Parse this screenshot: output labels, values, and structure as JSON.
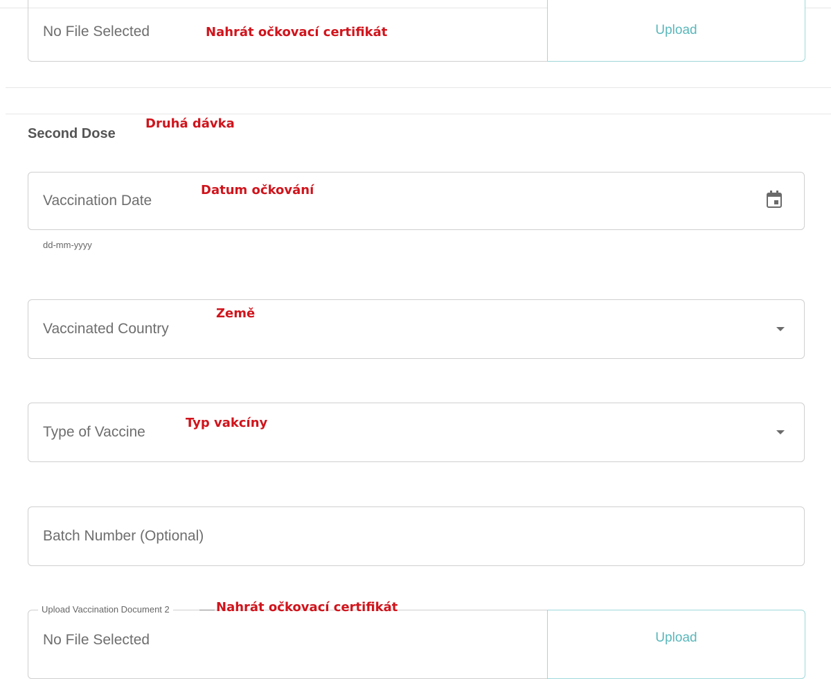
{
  "top_upload": {
    "file_status": "No File Selected",
    "annotation": "Nahrát očkovací certifikát",
    "button_label": "Upload"
  },
  "second_dose": {
    "heading": "Second Dose",
    "heading_annotation": "Druhá dávka",
    "vaccination_date": {
      "placeholder": "Vaccination Date",
      "annotation": "Datum očkování",
      "helper": "dd-mm-yyyy",
      "icon": "calendar-icon"
    },
    "vaccinated_country": {
      "placeholder": "Vaccinated Country",
      "annotation": "Země",
      "icon": "dropdown-caret-icon"
    },
    "vaccine_type": {
      "placeholder": "Type of Vaccine",
      "annotation": "Typ vakcíny",
      "icon": "dropdown-caret-icon"
    },
    "batch_number": {
      "placeholder": "Batch Number (Optional)"
    },
    "upload_document": {
      "legend": "Upload Vaccination Document 2",
      "annotation": "Nahrát očkovací certifikát",
      "file_status": "No File Selected",
      "button_label": "Upload"
    }
  },
  "colors": {
    "annotation_red": "#d0141c",
    "upload_teal": "#59b7bb",
    "border_gray": "#cfcfcf"
  }
}
